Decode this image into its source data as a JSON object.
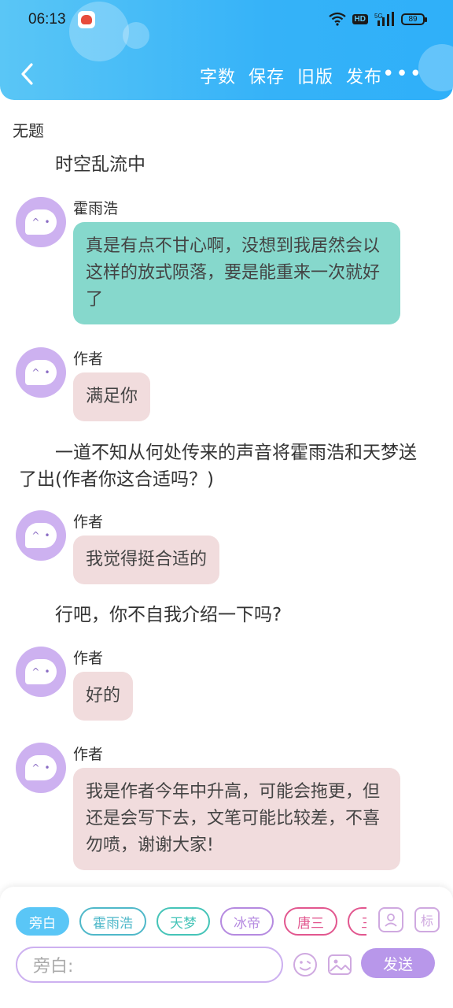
{
  "status_bar": {
    "time": "06:13",
    "network": "5G",
    "hd": "HD",
    "battery": "89"
  },
  "header": {
    "back_icon": "chevron-left-icon",
    "actions": [
      "字数",
      "保存",
      "旧版",
      "发布"
    ],
    "more": "•••"
  },
  "story": {
    "title": "无题",
    "blocks": [
      {
        "type": "narration",
        "text": "时空乱流中"
      },
      {
        "type": "message",
        "speaker": "霍雨浩",
        "text": "真是有点不甘心啊，没想到我居然会以这样的放式陨落，要是能重来一次就好了",
        "color": "#86d8cc"
      },
      {
        "type": "message",
        "speaker": "作者",
        "text": "满足你",
        "color": "#f1dcdd"
      },
      {
        "type": "narration",
        "text": "一道不知从何处传来的声音将霍雨浩和天梦送了出(作者你这合适吗？)"
      },
      {
        "type": "message",
        "speaker": "作者",
        "text": "我觉得挺合适的",
        "color": "#f1dcdd"
      },
      {
        "type": "narration",
        "text": "行吧，你不自我介绍一下吗?"
      },
      {
        "type": "message",
        "speaker": "作者",
        "text": "好的",
        "color": "#f1dcdd"
      },
      {
        "type": "message",
        "speaker": "作者",
        "text": "我是作者今年中升高，可能会拖更，但还是会写下去，文笔可能比较差，不喜勿喷，谢谢大家!",
        "color": "#f1dcdd"
      }
    ]
  },
  "input_panel": {
    "chips": [
      {
        "label": "旁白",
        "color": "#5ac6f6",
        "active": true
      },
      {
        "label": "霍雨浩",
        "color": "#4fb8c9",
        "active": false
      },
      {
        "label": "天梦",
        "color": "#45c4b8",
        "active": false
      },
      {
        "label": "冰帝",
        "color": "#b58ae0",
        "active": false
      },
      {
        "label": "唐三",
        "color": "#e2578f",
        "active": false
      },
      {
        "label": "三",
        "color": "#e2578f",
        "active": false
      }
    ],
    "role_icon": "person-card-icon",
    "tag_label": "标",
    "placeholder": "旁白:",
    "emoji_icon": "smiley-icon",
    "image_icon": "image-icon",
    "send_label": "发送"
  }
}
